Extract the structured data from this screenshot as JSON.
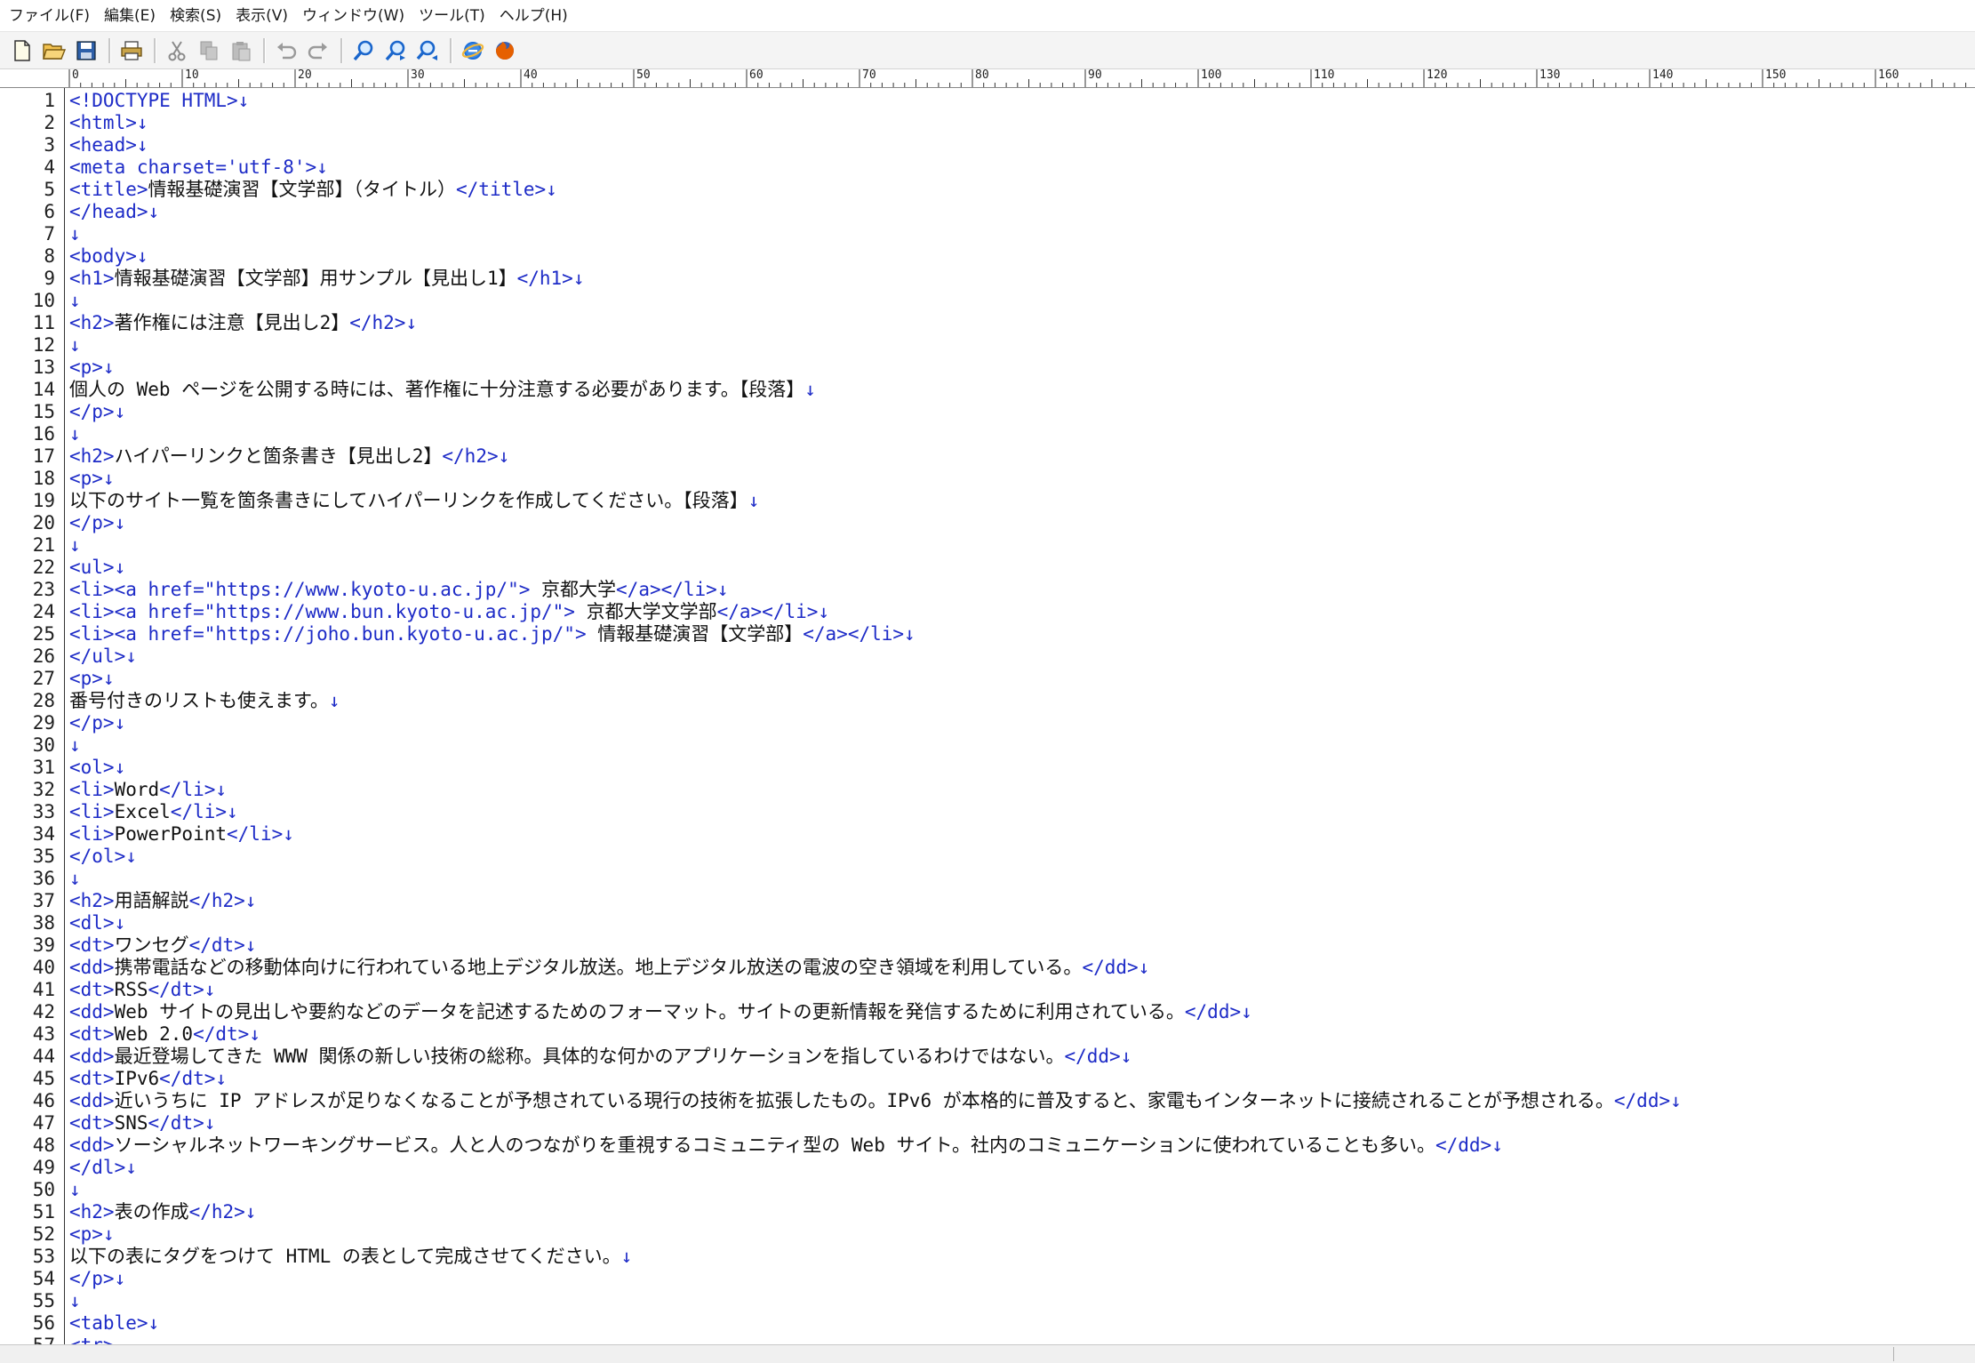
{
  "menubar": {
    "items": [
      "ファイル(F)",
      "編集(E)",
      "検索(S)",
      "表示(V)",
      "ウィンドウ(W)",
      "ツール(T)",
      "ヘルプ(H)"
    ]
  },
  "toolbar": {
    "buttons": [
      "new-file-icon",
      "open-folder-icon",
      "save-icon",
      "print-icon",
      "cut-icon",
      "copy-icon",
      "paste-icon",
      "undo-icon",
      "redo-icon",
      "search-icon",
      "search-next-icon",
      "search-prev-icon",
      "browser-ie-icon",
      "browser-firefox-icon"
    ],
    "colors": {
      "search": "#1a66cc",
      "firefox": "#e66000",
      "ie": "#1e6fd9"
    }
  },
  "ruler": {
    "labels": [
      "0",
      "10",
      "20",
      "30",
      "40",
      "50",
      "60",
      "70",
      "80",
      "90",
      "100",
      "110",
      "120",
      "130",
      "140",
      "150",
      "160"
    ]
  },
  "editor": {
    "colors": {
      "tag": "#1d2bc7",
      "text": "#111111"
    },
    "eol_mark": "↓",
    "lines": [
      {
        "n": "1",
        "segs": [
          [
            "tag",
            "<!DOCTYPE HTML>"
          ]
        ]
      },
      {
        "n": "2",
        "segs": [
          [
            "tag",
            "<html>"
          ]
        ]
      },
      {
        "n": "3",
        "segs": [
          [
            "tag",
            "<head>"
          ]
        ]
      },
      {
        "n": "4",
        "segs": [
          [
            "tag",
            "<meta charset='utf-8'>"
          ]
        ]
      },
      {
        "n": "5",
        "segs": [
          [
            "tag",
            "<title>"
          ],
          [
            "txt",
            "情報基礎演習【文学部】（タイトル）"
          ],
          [
            "tag",
            "</title>"
          ]
        ]
      },
      {
        "n": "6",
        "segs": [
          [
            "tag",
            "</head>"
          ]
        ]
      },
      {
        "n": "7",
        "segs": []
      },
      {
        "n": "8",
        "segs": [
          [
            "tag",
            "<body>"
          ]
        ]
      },
      {
        "n": "9",
        "segs": [
          [
            "tag",
            "<h1>"
          ],
          [
            "txt",
            "情報基礎演習【文学部】用サンプル【見出し1】"
          ],
          [
            "tag",
            "</h1>"
          ]
        ]
      },
      {
        "n": "10",
        "segs": []
      },
      {
        "n": "11",
        "segs": [
          [
            "tag",
            "<h2>"
          ],
          [
            "txt",
            "著作権には注意【見出し2】"
          ],
          [
            "tag",
            "</h2>"
          ]
        ]
      },
      {
        "n": "12",
        "segs": []
      },
      {
        "n": "13",
        "segs": [
          [
            "tag",
            "<p>"
          ]
        ]
      },
      {
        "n": "14",
        "segs": [
          [
            "txt",
            "個人の Web ページを公開する時には、著作権に十分注意する必要があります。【段落】"
          ]
        ]
      },
      {
        "n": "15",
        "segs": [
          [
            "tag",
            "</p>"
          ]
        ]
      },
      {
        "n": "16",
        "segs": []
      },
      {
        "n": "17",
        "segs": [
          [
            "tag",
            "<h2>"
          ],
          [
            "txt",
            "ハイパーリンクと箇条書き【見出し2】"
          ],
          [
            "tag",
            "</h2>"
          ]
        ]
      },
      {
        "n": "18",
        "segs": [
          [
            "tag",
            "<p>"
          ]
        ]
      },
      {
        "n": "19",
        "segs": [
          [
            "txt",
            "以下のサイト一覧を箇条書きにしてハイパーリンクを作成してください。【段落】"
          ]
        ]
      },
      {
        "n": "20",
        "segs": [
          [
            "tag",
            "</p>"
          ]
        ]
      },
      {
        "n": "21",
        "segs": []
      },
      {
        "n": "22",
        "segs": [
          [
            "tag",
            "<ul>"
          ]
        ]
      },
      {
        "n": "23",
        "segs": [
          [
            "tag",
            "<li><a href=\"https://www.kyoto-u.ac.jp/\">"
          ],
          [
            "txt",
            " 京都大学"
          ],
          [
            "tag",
            "</a></li>"
          ]
        ]
      },
      {
        "n": "24",
        "segs": [
          [
            "tag",
            "<li><a href=\"https://www.bun.kyoto-u.ac.jp/\">"
          ],
          [
            "txt",
            " 京都大学文学部"
          ],
          [
            "tag",
            "</a></li>"
          ]
        ]
      },
      {
        "n": "25",
        "segs": [
          [
            "tag",
            "<li><a href=\"https://joho.bun.kyoto-u.ac.jp/\">"
          ],
          [
            "txt",
            " 情報基礎演習【文学部】"
          ],
          [
            "tag",
            "</a></li>"
          ]
        ]
      },
      {
        "n": "26",
        "segs": [
          [
            "tag",
            "</ul>"
          ]
        ]
      },
      {
        "n": "27",
        "segs": [
          [
            "tag",
            "<p>"
          ]
        ]
      },
      {
        "n": "28",
        "segs": [
          [
            "txt",
            "番号付きのリストも使えます。"
          ]
        ]
      },
      {
        "n": "29",
        "segs": [
          [
            "tag",
            "</p>"
          ]
        ]
      },
      {
        "n": "30",
        "segs": []
      },
      {
        "n": "31",
        "segs": [
          [
            "tag",
            "<ol>"
          ]
        ]
      },
      {
        "n": "32",
        "segs": [
          [
            "tag",
            "<li>"
          ],
          [
            "txt",
            "Word"
          ],
          [
            "tag",
            "</li>"
          ]
        ]
      },
      {
        "n": "33",
        "segs": [
          [
            "tag",
            "<li>"
          ],
          [
            "txt",
            "Excel"
          ],
          [
            "tag",
            "</li>"
          ]
        ]
      },
      {
        "n": "34",
        "segs": [
          [
            "tag",
            "<li>"
          ],
          [
            "txt",
            "PowerPoint"
          ],
          [
            "tag",
            "</li>"
          ]
        ]
      },
      {
        "n": "35",
        "segs": [
          [
            "tag",
            "</ol>"
          ]
        ]
      },
      {
        "n": "36",
        "segs": []
      },
      {
        "n": "37",
        "segs": [
          [
            "tag",
            "<h2>"
          ],
          [
            "txt",
            "用語解説"
          ],
          [
            "tag",
            "</h2>"
          ]
        ]
      },
      {
        "n": "38",
        "segs": [
          [
            "tag",
            "<dl>"
          ]
        ]
      },
      {
        "n": "39",
        "segs": [
          [
            "tag",
            "<dt>"
          ],
          [
            "txt",
            "ワンセグ"
          ],
          [
            "tag",
            "</dt>"
          ]
        ]
      },
      {
        "n": "40",
        "segs": [
          [
            "tag",
            "<dd>"
          ],
          [
            "txt",
            "携帯電話などの移動体向けに行われている地上デジタル放送。地上デジタル放送の電波の空き領域を利用している。"
          ],
          [
            "tag",
            "</dd>"
          ]
        ]
      },
      {
        "n": "41",
        "segs": [
          [
            "tag",
            "<dt>"
          ],
          [
            "txt",
            "RSS"
          ],
          [
            "tag",
            "</dt>"
          ]
        ]
      },
      {
        "n": "42",
        "segs": [
          [
            "tag",
            "<dd>"
          ],
          [
            "txt",
            "Web サイトの見出しや要約などのデータを記述するためのフォーマット。サイトの更新情報を発信するために利用されている。"
          ],
          [
            "tag",
            "</dd>"
          ]
        ]
      },
      {
        "n": "43",
        "segs": [
          [
            "tag",
            "<dt>"
          ],
          [
            "txt",
            "Web 2.0"
          ],
          [
            "tag",
            "</dt>"
          ]
        ]
      },
      {
        "n": "44",
        "segs": [
          [
            "tag",
            "<dd>"
          ],
          [
            "txt",
            "最近登場してきた WWW 関係の新しい技術の総称。具体的な何かのアプリケーションを指しているわけではない。"
          ],
          [
            "tag",
            "</dd>"
          ]
        ]
      },
      {
        "n": "45",
        "segs": [
          [
            "tag",
            "<dt>"
          ],
          [
            "txt",
            "IPv6"
          ],
          [
            "tag",
            "</dt>"
          ]
        ]
      },
      {
        "n": "46",
        "segs": [
          [
            "tag",
            "<dd>"
          ],
          [
            "txt",
            "近いうちに IP アドレスが足りなくなることが予想されている現行の技術を拡張したもの。IPv6 が本格的に普及すると、家電もインターネットに接続されることが予想される。"
          ],
          [
            "tag",
            "</dd>"
          ]
        ]
      },
      {
        "n": "47",
        "segs": [
          [
            "tag",
            "<dt>"
          ],
          [
            "txt",
            "SNS"
          ],
          [
            "tag",
            "</dt>"
          ]
        ]
      },
      {
        "n": "48",
        "segs": [
          [
            "tag",
            "<dd>"
          ],
          [
            "txt",
            "ソーシャルネットワーキングサービス。人と人のつながりを重視するコミュニティ型の Web サイト。社内のコミュニケーションに使われていることも多い。"
          ],
          [
            "tag",
            "</dd>"
          ]
        ]
      },
      {
        "n": "49",
        "segs": [
          [
            "tag",
            "</dl>"
          ]
        ]
      },
      {
        "n": "50",
        "segs": []
      },
      {
        "n": "51",
        "segs": [
          [
            "tag",
            "<h2>"
          ],
          [
            "txt",
            "表の作成"
          ],
          [
            "tag",
            "</h2>"
          ]
        ]
      },
      {
        "n": "52",
        "segs": [
          [
            "tag",
            "<p>"
          ]
        ]
      },
      {
        "n": "53",
        "segs": [
          [
            "txt",
            "以下の表にタグをつけて HTML の表として完成させてください。"
          ]
        ]
      },
      {
        "n": "54",
        "segs": [
          [
            "tag",
            "</p>"
          ]
        ]
      },
      {
        "n": "55",
        "segs": []
      },
      {
        "n": "56",
        "segs": [
          [
            "tag",
            "<table>"
          ]
        ]
      },
      {
        "n": "57",
        "segs": [
          [
            "tag",
            "<tr>"
          ]
        ]
      }
    ]
  }
}
